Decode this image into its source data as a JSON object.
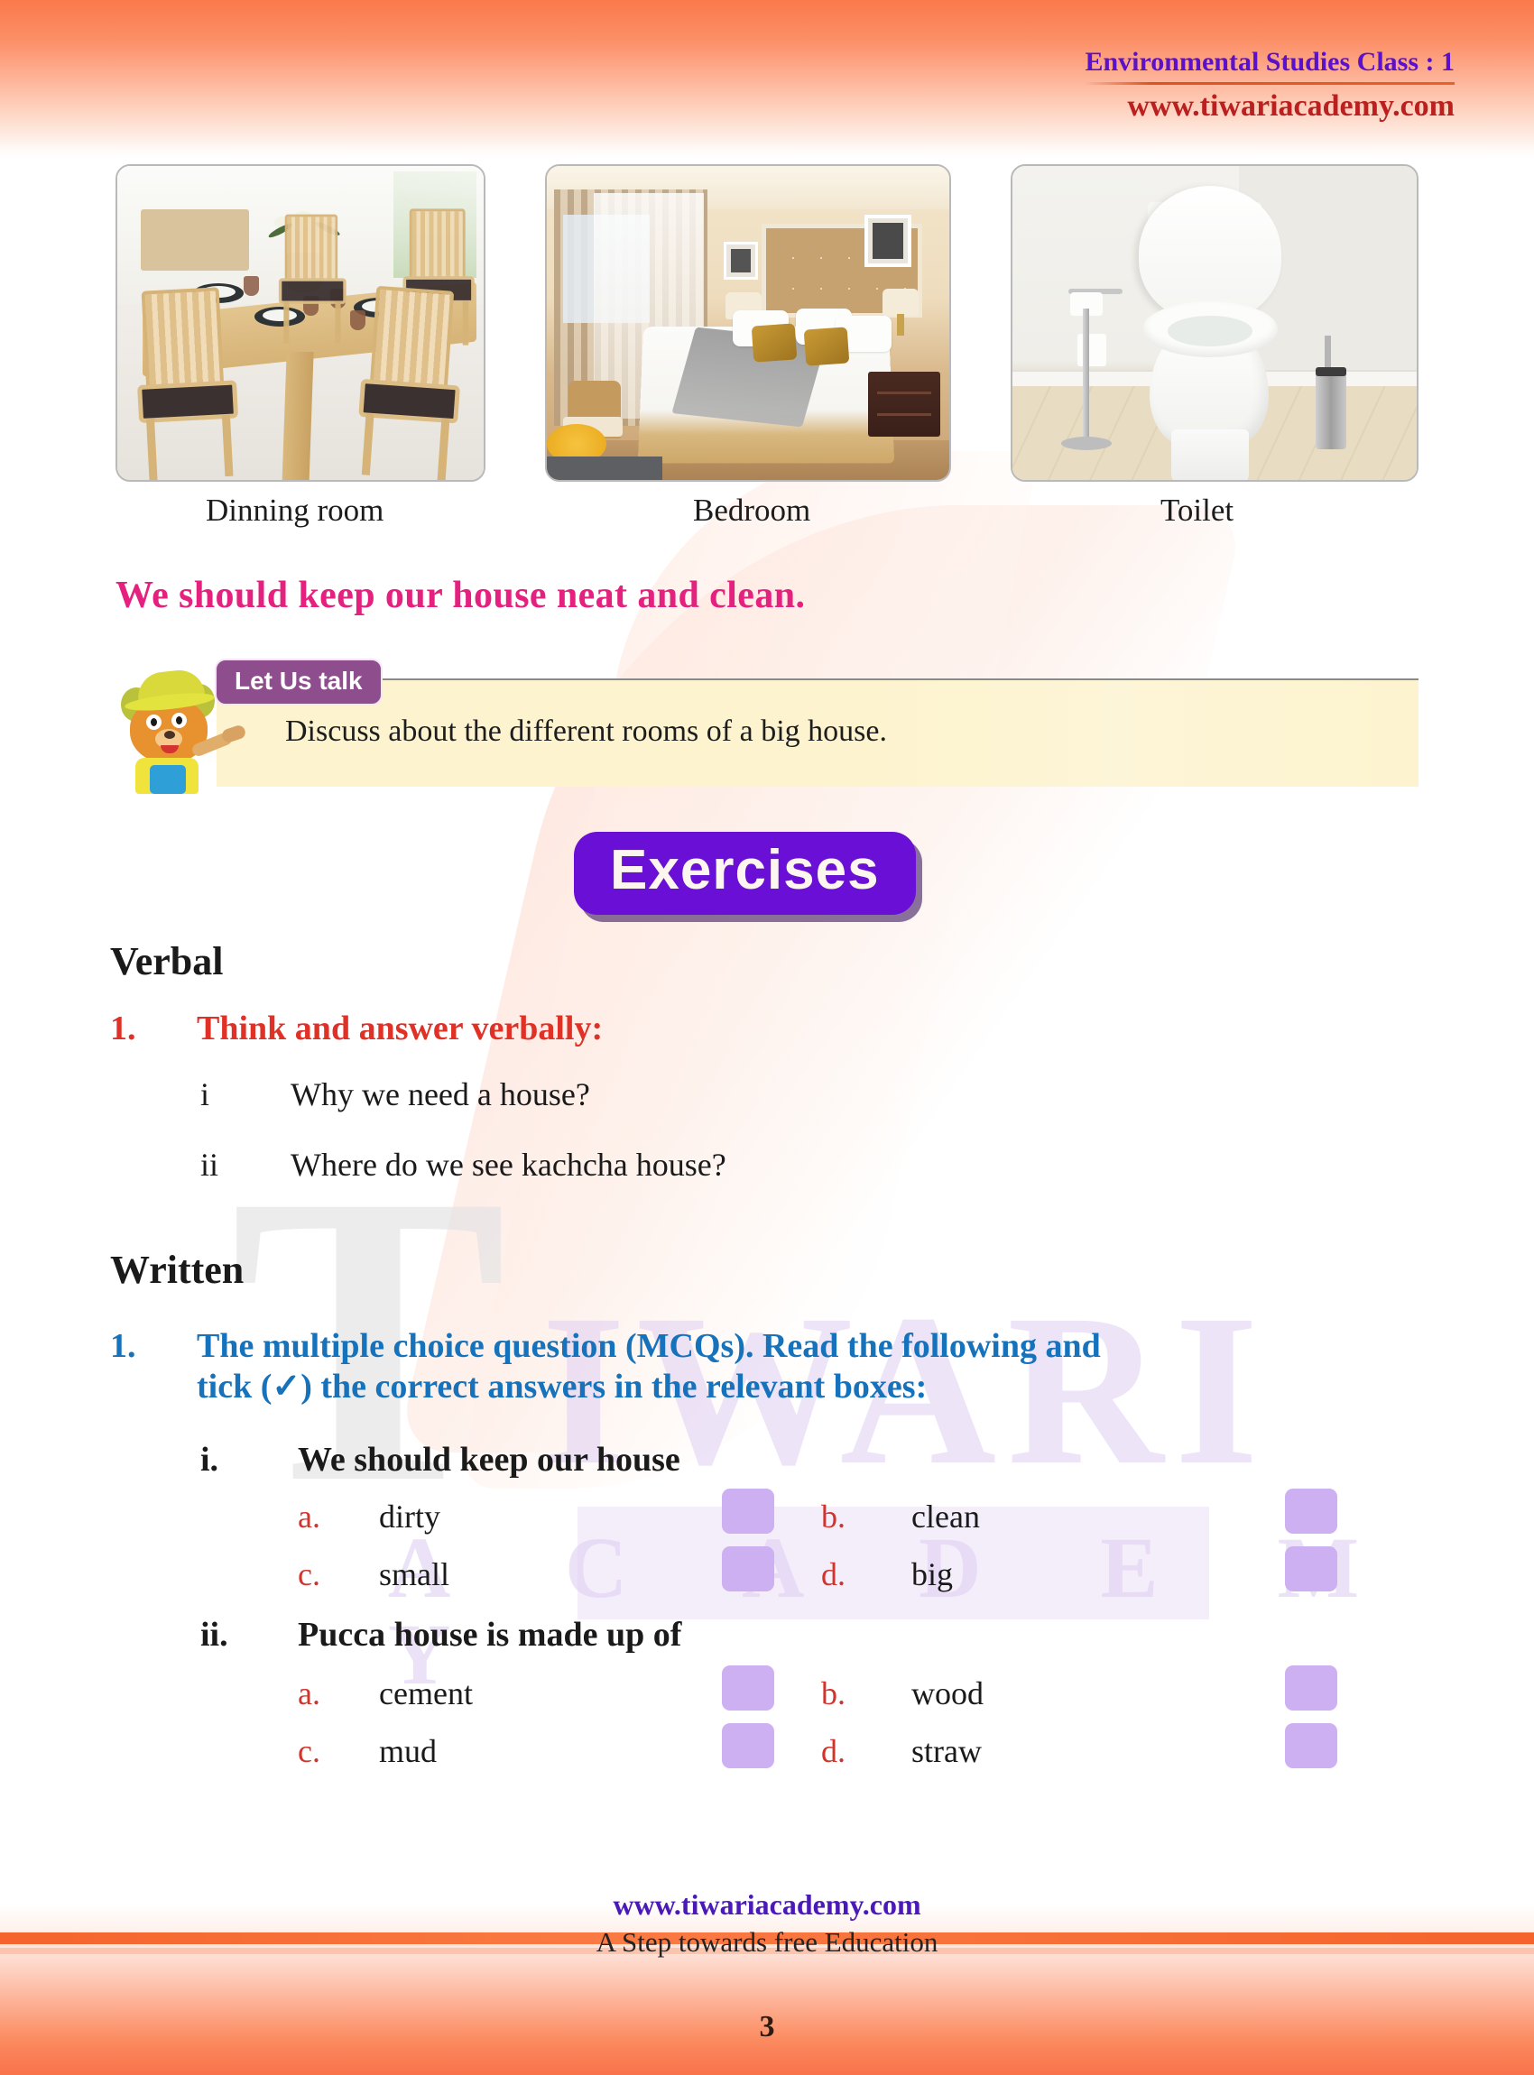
{
  "header": {
    "subject_title": "Environmental Studies Class : 1",
    "site": "www.tiwariacademy.com"
  },
  "photos": [
    {
      "caption": "Dinning room",
      "alt_name": "dining-room-photo"
    },
    {
      "caption": "Bedroom",
      "alt_name": "bedroom-photo"
    },
    {
      "caption": "Toilet",
      "alt_name": "toilet-photo"
    }
  ],
  "statement": "We should keep our house neat and clean.",
  "let_us_talk": {
    "badge": "Let Us talk",
    "text": "Discuss about the different rooms of a big house.",
    "mascot": "bear-mascot-icon"
  },
  "exercises_banner": "Exercises",
  "verbal": {
    "heading": "Verbal",
    "question_number": "1.",
    "question_title": "Think and answer verbally:",
    "items": [
      {
        "num": "i",
        "text": "Why we need a house?"
      },
      {
        "num": "ii",
        "text": "Where do we see kachcha house?"
      }
    ]
  },
  "written": {
    "heading": "Written",
    "question_number": "1.",
    "instruction_line1": "The multiple choice question (MCQs). Read the following and",
    "instruction_line2": "tick (✓) the correct answers in the relevant boxes:",
    "questions": [
      {
        "num": "i.",
        "text": "We should keep our house",
        "options": [
          {
            "letter": "a.",
            "text": "dirty"
          },
          {
            "letter": "b.",
            "text": "clean"
          },
          {
            "letter": "c.",
            "text": "small"
          },
          {
            "letter": "d.",
            "text": "big"
          }
        ]
      },
      {
        "num": "ii.",
        "text": "Pucca house is made up of",
        "options": [
          {
            "letter": "a.",
            "text": "cement"
          },
          {
            "letter": "b.",
            "text": "wood"
          },
          {
            "letter": "c.",
            "text": "mud"
          },
          {
            "letter": "d.",
            "text": "straw"
          }
        ]
      }
    ]
  },
  "footer": {
    "site": "www.tiwariacademy.com",
    "tagline": "A Step towards free Education",
    "page_number": "3"
  },
  "watermark": {
    "letter": "T",
    "word": "IWARI",
    "word2": "A C A D E M Y"
  },
  "colors": {
    "header_purple": "#5b11c9",
    "header_red": "#bb1f1f",
    "pink": "#e5217f",
    "exercise_purple": "#6a0fd6",
    "badge_purple": "#8e4e8e",
    "red": "#e03127",
    "blue": "#1572bb",
    "tickbox": "#cdb0f2",
    "panel_yellow": "#fdf3cf"
  }
}
